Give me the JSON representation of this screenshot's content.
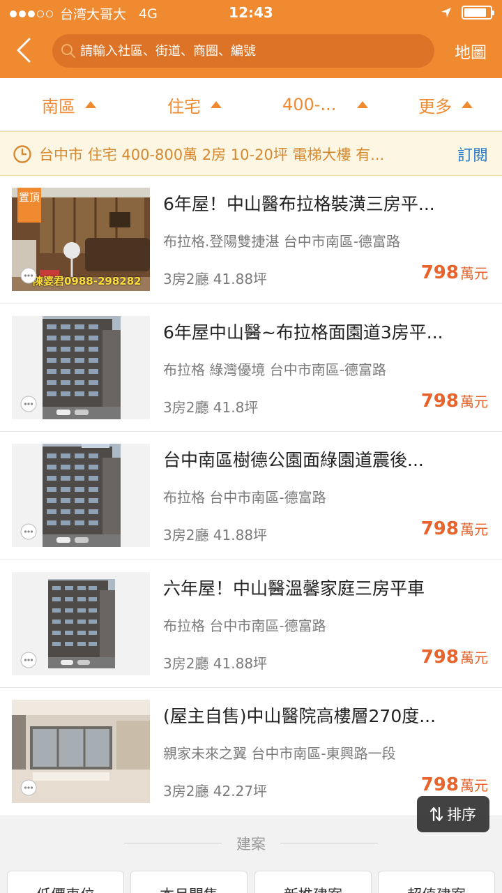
{
  "status_bar": {
    "carrier": "台湾大哥大",
    "network": "4G",
    "time": "12:43",
    "signal_bars_filled": 3,
    "signal_bars_total": 5,
    "battery_level": 0.85
  },
  "nav": {
    "search_placeholder": "請輸入社區、街道、商圈、編號",
    "map_label": "地圖"
  },
  "filters": [
    {
      "label": "南區"
    },
    {
      "label": "住宅"
    },
    {
      "label": "400-..."
    },
    {
      "label": "更多"
    }
  ],
  "saved_search": {
    "criteria": "台中市 住宅 400-800萬 2房 10-20坪 電梯大樓 有...",
    "subscribe_label": "訂閱"
  },
  "listings": [
    {
      "title": "6年屋！中山醫布拉格裝潢三房平...",
      "subtitle": "布拉格.登陽雙捷湛 台中市南區-德富路",
      "spec": "3房2廳  41.88坪",
      "price": "798",
      "price_unit": "萬元",
      "badge": "置頂",
      "watermark": "陳婆君0988-298282",
      "photo": "livingroom"
    },
    {
      "title": "6年屋中山醫~布拉格面園道3房平...",
      "subtitle": "布拉格 綠灣優境 台中市南區-德富路",
      "spec": "3房2廳  41.8坪",
      "price": "798",
      "price_unit": "萬元",
      "photo": "building"
    },
    {
      "title": "台中南區樹德公園面綠園道震後...",
      "subtitle": "布拉格 台中市南區-德富路",
      "spec": "3房2廳  41.88坪",
      "price": "798",
      "price_unit": "萬元",
      "photo": "building"
    },
    {
      "title": "六年屋！中山醫溫馨家庭三房平車",
      "subtitle": "布拉格 台中市南區-德富路",
      "spec": "3房2廳  41.88坪",
      "price": "798",
      "price_unit": "萬元",
      "photo": "building"
    },
    {
      "title": "(屋主自售)中山醫院高樓層270度...",
      "subtitle": "親家未來之翼 台中市南區-東興路一段",
      "spec": "3房2廳  42.27坪",
      "price": "798",
      "price_unit": "萬元",
      "photo": "interior"
    }
  ],
  "sort_button": {
    "label": "排序"
  },
  "new_projects": {
    "section_title": "建案",
    "tags": [
      "低價車位",
      "本月開售",
      "新推建案",
      "超值建案"
    ]
  },
  "colors": {
    "brand_orange": "#ef8a31",
    "price_red": "#e8632b",
    "link_blue": "#2a7bc4"
  }
}
